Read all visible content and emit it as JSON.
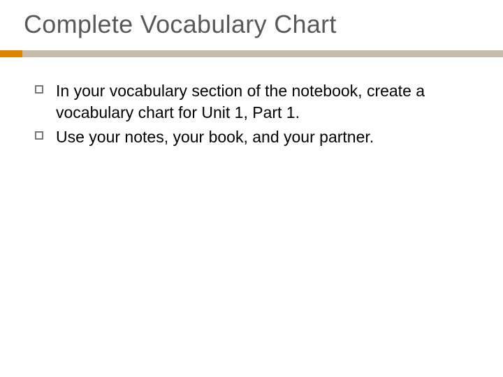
{
  "title": "Complete Vocabulary Chart",
  "bullets": {
    "b0": "In your vocabulary section of the notebook, create a vocabulary chart for Unit 1, Part 1.",
    "b1": "Use your notes, your book, and your partner."
  }
}
